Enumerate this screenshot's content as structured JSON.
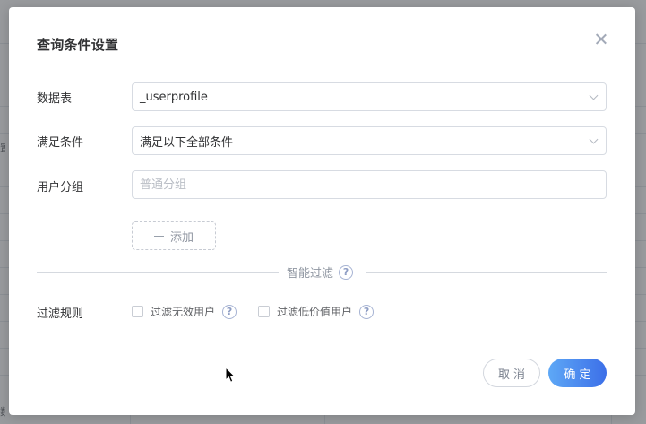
{
  "background": {
    "fragments": [
      "置",
      "数"
    ]
  },
  "dialog": {
    "title": "查询条件设置",
    "table": {
      "label": "数据表",
      "value": "_userprofile"
    },
    "condition": {
      "label": "满足条件",
      "value": "满足以下全部条件"
    },
    "group": {
      "label": "用户分组",
      "placeholder": "普通分组"
    },
    "add_label": "添加",
    "divider_label": "智能过滤",
    "filter_rules": {
      "label": "过滤规则",
      "options": [
        {
          "label": "过滤无效用户",
          "checked": false
        },
        {
          "label": "过滤低价值用户",
          "checked": false
        }
      ]
    },
    "help_glyph": "?",
    "cancel_label": "取消",
    "ok_label": "确定"
  },
  "colors": {
    "primary_gradient_start": "#5ea8f6",
    "primary_gradient_end": "#3c6fe8",
    "overlay": "#46484e"
  }
}
